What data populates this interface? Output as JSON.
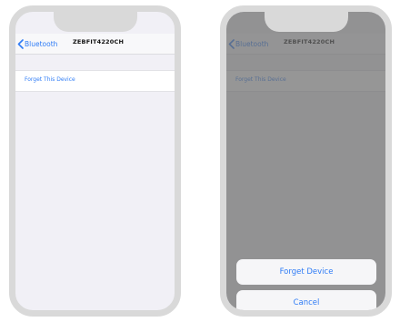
{
  "settings_screen": {
    "back_label": "Bluetooth",
    "device_name": "ZEBFIT4220CH",
    "forget_row_label": "Forget This Device"
  },
  "action_sheet": {
    "forget_label": "Forget Device",
    "cancel_label": "Cancel"
  },
  "colors": {
    "accent": "#2f7cf6",
    "frame": "#d9d9d9",
    "background": "#f1f0f6"
  },
  "icons": {
    "back": "chevron-left-icon"
  }
}
